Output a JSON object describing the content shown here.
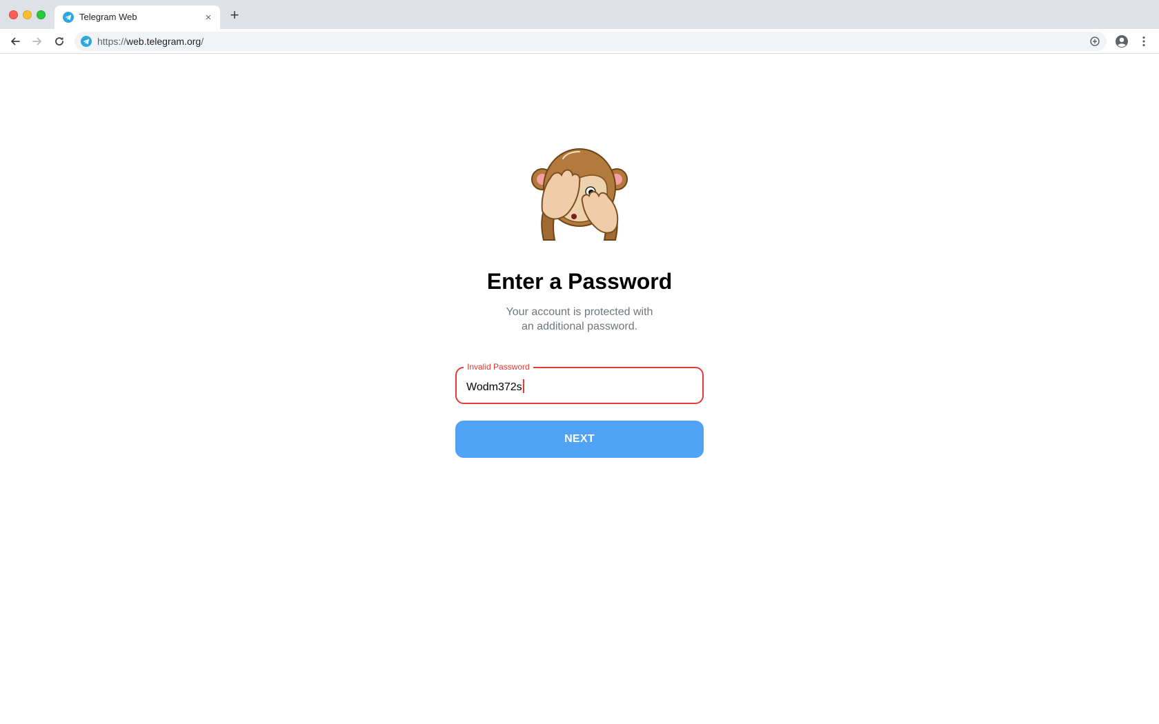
{
  "browser": {
    "tab": {
      "title": "Telegram Web",
      "close_icon": "×"
    },
    "new_tab_icon": "+",
    "url": {
      "scheme": "https://",
      "host": "web.telegram.org",
      "path": "/"
    }
  },
  "login": {
    "title": "Enter a Password",
    "subtitle_line1": "Your account is protected with",
    "subtitle_line2": "an additional password.",
    "password_field": {
      "label": "Invalid Password",
      "value": "Wodm372s",
      "state": "error"
    },
    "next_button": "NEXT"
  },
  "colors": {
    "accent": "#50a2f5",
    "error": "#e53935",
    "telegram_brand": "#2ea6e0",
    "subtitle": "#707579"
  },
  "icons": [
    "telegram-icon",
    "close-icon",
    "plus-icon",
    "back-arrow-icon",
    "forward-arrow-icon",
    "reload-icon",
    "add-circle-icon",
    "profile-icon",
    "more-vert-icon",
    "monkey-sticker"
  ]
}
